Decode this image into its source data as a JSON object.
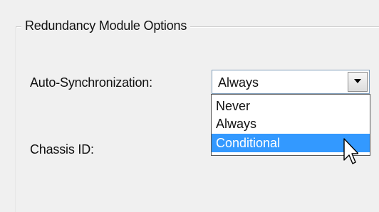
{
  "group": {
    "title": "Redundancy Module Options"
  },
  "fields": {
    "auto_sync_label": "Auto-Synchronization:",
    "chassis_id_label": "Chassis ID:"
  },
  "auto_sync_combo": {
    "value": "Always",
    "options": [
      "Never",
      "Always",
      "Conditional"
    ],
    "highlighted": "Conditional"
  },
  "colors": {
    "selection": "#3399ff",
    "background": "#f0f0f0"
  },
  "icons": {
    "dropdown_arrow": "chevron-down-icon",
    "cursor": "mouse-pointer-icon"
  }
}
